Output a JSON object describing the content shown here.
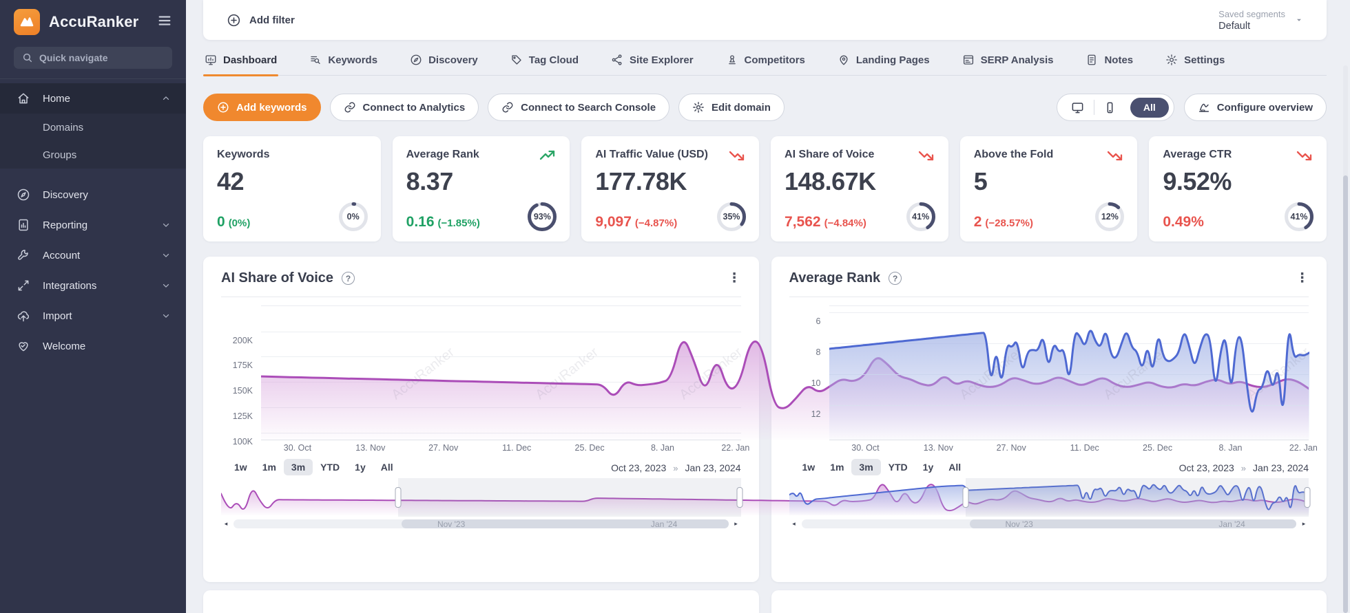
{
  "sidebar": {
    "brand": "AccuRanker",
    "search_placeholder": "Quick navigate",
    "items": [
      {
        "icon": "home-icon",
        "label": "Home",
        "chevron": "up",
        "active": true,
        "children": [
          "Domains",
          "Groups"
        ]
      },
      {
        "icon": "compass-icon",
        "label": "Discovery"
      },
      {
        "icon": "report-icon",
        "label": "Reporting",
        "chevron": "down"
      },
      {
        "icon": "wrench-icon",
        "label": "Account",
        "chevron": "down"
      },
      {
        "icon": "integrations-icon",
        "label": "Integrations",
        "chevron": "down"
      },
      {
        "icon": "cloud-upload-icon",
        "label": "Import",
        "chevron": "down"
      },
      {
        "icon": "heart-icon",
        "label": "Welcome"
      }
    ]
  },
  "topbar": {
    "add_filter": "Add filter",
    "saved_segments_label": "Saved segments",
    "saved_segments_value": "Default"
  },
  "tabs": [
    {
      "icon": "dashboard-icon",
      "label": "Dashboard",
      "active": true
    },
    {
      "icon": "keywords-icon",
      "label": "Keywords"
    },
    {
      "icon": "compass-icon",
      "label": "Discovery"
    },
    {
      "icon": "tag-icon",
      "label": "Tag Cloud"
    },
    {
      "icon": "sitemap-icon",
      "label": "Site Explorer"
    },
    {
      "icon": "pawn-icon",
      "label": "Competitors"
    },
    {
      "icon": "pin-icon",
      "label": "Landing Pages"
    },
    {
      "icon": "serp-icon",
      "label": "SERP Analysis"
    },
    {
      "icon": "notes-icon",
      "label": "Notes"
    },
    {
      "icon": "gear-icon",
      "label": "Settings"
    }
  ],
  "actions": {
    "add_keywords": "Add keywords",
    "connect_analytics": "Connect to Analytics",
    "connect_search_console": "Connect to Search Console",
    "edit_domain": "Edit domain",
    "device_all": "All",
    "configure_overview": "Configure overview"
  },
  "kpis": [
    {
      "title": "Keywords",
      "value": "42",
      "change": "0",
      "change_pct": "(0%)",
      "trend": "none",
      "change_color": "green",
      "donut_pct": 0,
      "donut_label": "0%"
    },
    {
      "title": "Average Rank",
      "value": "8.37",
      "change": "0.16",
      "change_pct": "(−1.85%)",
      "trend": "up",
      "change_color": "green",
      "donut_pct": 93,
      "donut_label": "93%"
    },
    {
      "title": "AI Traffic Value (USD)",
      "value": "177.78K",
      "change": "9,097",
      "change_pct": "(−4.87%)",
      "trend": "down",
      "change_color": "red",
      "donut_pct": 35,
      "donut_label": "35%"
    },
    {
      "title": "AI Share of Voice",
      "value": "148.67K",
      "change": "7,562",
      "change_pct": "(−4.84%)",
      "trend": "down",
      "change_color": "red",
      "donut_pct": 41,
      "donut_label": "41%"
    },
    {
      "title": "Above the Fold",
      "value": "5",
      "change": "2",
      "change_pct": "(−28.57%)",
      "trend": "down",
      "change_color": "red",
      "donut_pct": 12,
      "donut_label": "12%"
    },
    {
      "title": "Average CTR",
      "value": "9.52%",
      "change": "0.49%",
      "change_pct": "",
      "trend": "down",
      "change_color": "red",
      "donut_pct": 41,
      "donut_label": "41%"
    }
  ],
  "charts_common": {
    "range_buttons": [
      "1w",
      "1m",
      "3m",
      "YTD",
      "1y",
      "All"
    ],
    "selected_range": "3m",
    "date_from": "Oct 23, 2023",
    "date_separator": "»",
    "date_to": "Jan 23, 2024",
    "scrollbar_labels": [
      {
        "label": "Nov '23",
        "pct": 44
      },
      {
        "label": "Jan '24",
        "pct": 87
      }
    ],
    "watermark": "AccuRanker",
    "brush_selection_start_pct": 34
  },
  "chart_data": [
    {
      "type": "area",
      "title": "AI Share of Voice",
      "color": "#ab4db8",
      "fill_top": "#d9a7de",
      "direction": "up",
      "unit": "K",
      "ylim_top": 225,
      "ylim_bottom": 93,
      "y_ticks": [
        {
          "v": 200,
          "label": "200K"
        },
        {
          "v": 175,
          "label": "175K"
        },
        {
          "v": 150,
          "label": "150K"
        },
        {
          "v": 125,
          "label": "125K"
        },
        {
          "v": 100,
          "label": "100K"
        }
      ],
      "x_ticks": [
        {
          "label": "30. Oct",
          "pct": 7.6
        },
        {
          "label": "13. Nov",
          "pct": 22.8
        },
        {
          "label": "27. Nov",
          "pct": 38
        },
        {
          "label": "11. Dec",
          "pct": 53.3
        },
        {
          "label": "25. Dec",
          "pct": 68.5
        },
        {
          "label": "8. Jan",
          "pct": 83.7
        },
        {
          "label": "22. Jan",
          "pct": 98.9
        }
      ],
      "values": [
        155.5,
        155.2,
        154.9,
        154.7,
        154.4,
        154.1,
        153.9,
        153.6,
        153.3,
        153.1,
        152.8,
        152.5,
        152.3,
        152,
        151.7,
        151.5,
        151.2,
        150.9,
        150.7,
        150.4,
        150.1,
        149.9,
        149.6,
        149.3,
        149.1,
        148.8,
        148.5,
        148.3,
        148,
        147.8,
        147.5,
        133.5,
        151.5,
        146.5,
        147.5,
        149,
        153,
        197.5,
        172,
        137.5,
        176,
        141,
        147,
        192.5,
        187,
        127,
        122.5,
        134,
        147.5,
        139,
        146,
        153.5,
        150,
        156,
        176.5,
        168,
        155.5,
        153,
        147.5,
        146,
        157.5,
        146.5,
        152,
        147,
        144.5,
        147,
        155,
        151.5,
        147.5,
        150,
        155.5,
        151,
        146,
        150.5,
        155,
        147.5,
        144.5,
        147,
        150.5,
        145.5,
        144,
        148.5,
        146,
        150.5,
        153,
        147.5,
        151,
        146,
        144.5,
        148,
        153.5,
        151,
        143.5
      ],
      "brush_prefix": [
        167,
        120,
        149,
        117,
        186,
        148,
        125,
        152,
        151.4,
        151.3,
        151.2,
        151.1,
        151,
        150.9,
        150.8,
        150.7,
        150.6,
        150.5,
        150.4,
        150.3,
        150.2,
        150.1,
        150,
        149.9,
        149.8,
        149.7,
        149.6,
        149.5,
        149.4,
        149.3,
        149.2,
        149.1,
        149,
        148.9,
        148.8,
        148.7,
        148.6,
        148.5,
        148.4,
        148.3,
        148.2,
        148.1,
        148,
        147.9,
        147.8,
        147.7,
        147.6,
        147.5
      ]
    },
    {
      "type": "area",
      "title": "Average Rank",
      "color": "#4e69d2",
      "fill_top": "#a9b8e8",
      "direction": "down",
      "unit": "",
      "ylim_top": 5.6,
      "ylim_bottom": 14.2,
      "y_ticks": [
        {
          "v": 6,
          "label": "6"
        },
        {
          "v": 8,
          "label": "8"
        },
        {
          "v": 10,
          "label": "10"
        },
        {
          "v": 12,
          "label": "12"
        }
      ],
      "x_ticks": [
        {
          "label": "30. Oct",
          "pct": 7.6
        },
        {
          "label": "13. Nov",
          "pct": 22.8
        },
        {
          "label": "27. Nov",
          "pct": 38
        },
        {
          "label": "11. Dec",
          "pct": 53.3
        },
        {
          "label": "25. Dec",
          "pct": 68.5
        },
        {
          "label": "8. Jan",
          "pct": 83.7
        },
        {
          "label": "22. Jan",
          "pct": 98.9
        }
      ],
      "values": [
        8.35,
        8.31,
        8.28,
        8.24,
        8.21,
        8.17,
        8.14,
        8.1,
        8.07,
        8.03,
        8,
        7.96,
        7.93,
        7.89,
        7.86,
        7.82,
        7.79,
        7.75,
        7.72,
        7.68,
        7.65,
        7.61,
        7.58,
        7.54,
        7.51,
        7.47,
        7.44,
        7.4,
        7.37,
        7.33,
        7.3,
        10.8,
        8.2,
        10.9,
        8,
        8.3,
        7.7,
        10,
        8.5,
        8.4,
        8.5,
        7.4,
        9.7,
        7.9,
        8.6,
        8.3,
        10.7,
        7.2,
        7.5,
        8.3,
        6.9,
        7.9,
        8.3,
        7,
        8.8,
        9,
        8,
        7.1,
        8.3,
        8.5,
        9.8,
        8,
        10.1,
        7.2,
        8.9,
        9.2,
        9,
        8.6,
        7.1,
        8.2,
        9.6,
        8.3,
        7.3,
        7.6,
        11.2,
        8.4,
        7.4,
        11.5,
        7.7,
        7.5,
        10.7,
        12.9,
        11,
        10.9,
        9.4,
        11.1,
        9.3,
        13.2,
        6.5,
        9,
        8.7,
        8.8,
        8.6
      ],
      "brush_prefix": [
        9.3,
        8.7,
        9.9,
        8.5,
        10.9,
        11.4,
        10.7,
        10.2,
        10.15,
        10.1,
        10,
        9.9,
        9.82,
        9.74,
        9.66,
        9.58,
        9.5,
        9.42,
        9.34,
        9.26,
        9.18,
        9.1,
        9.02,
        8.94,
        8.86,
        8.78,
        8.7,
        8.62,
        8.54,
        8.46,
        8.38,
        8.3,
        8.22,
        8.14,
        8.06,
        7.98,
        7.9,
        7.82,
        7.74,
        7.66,
        7.6,
        7.55,
        7.5,
        7.45,
        7.42,
        7.39,
        7.36,
        7.33
      ]
    }
  ]
}
